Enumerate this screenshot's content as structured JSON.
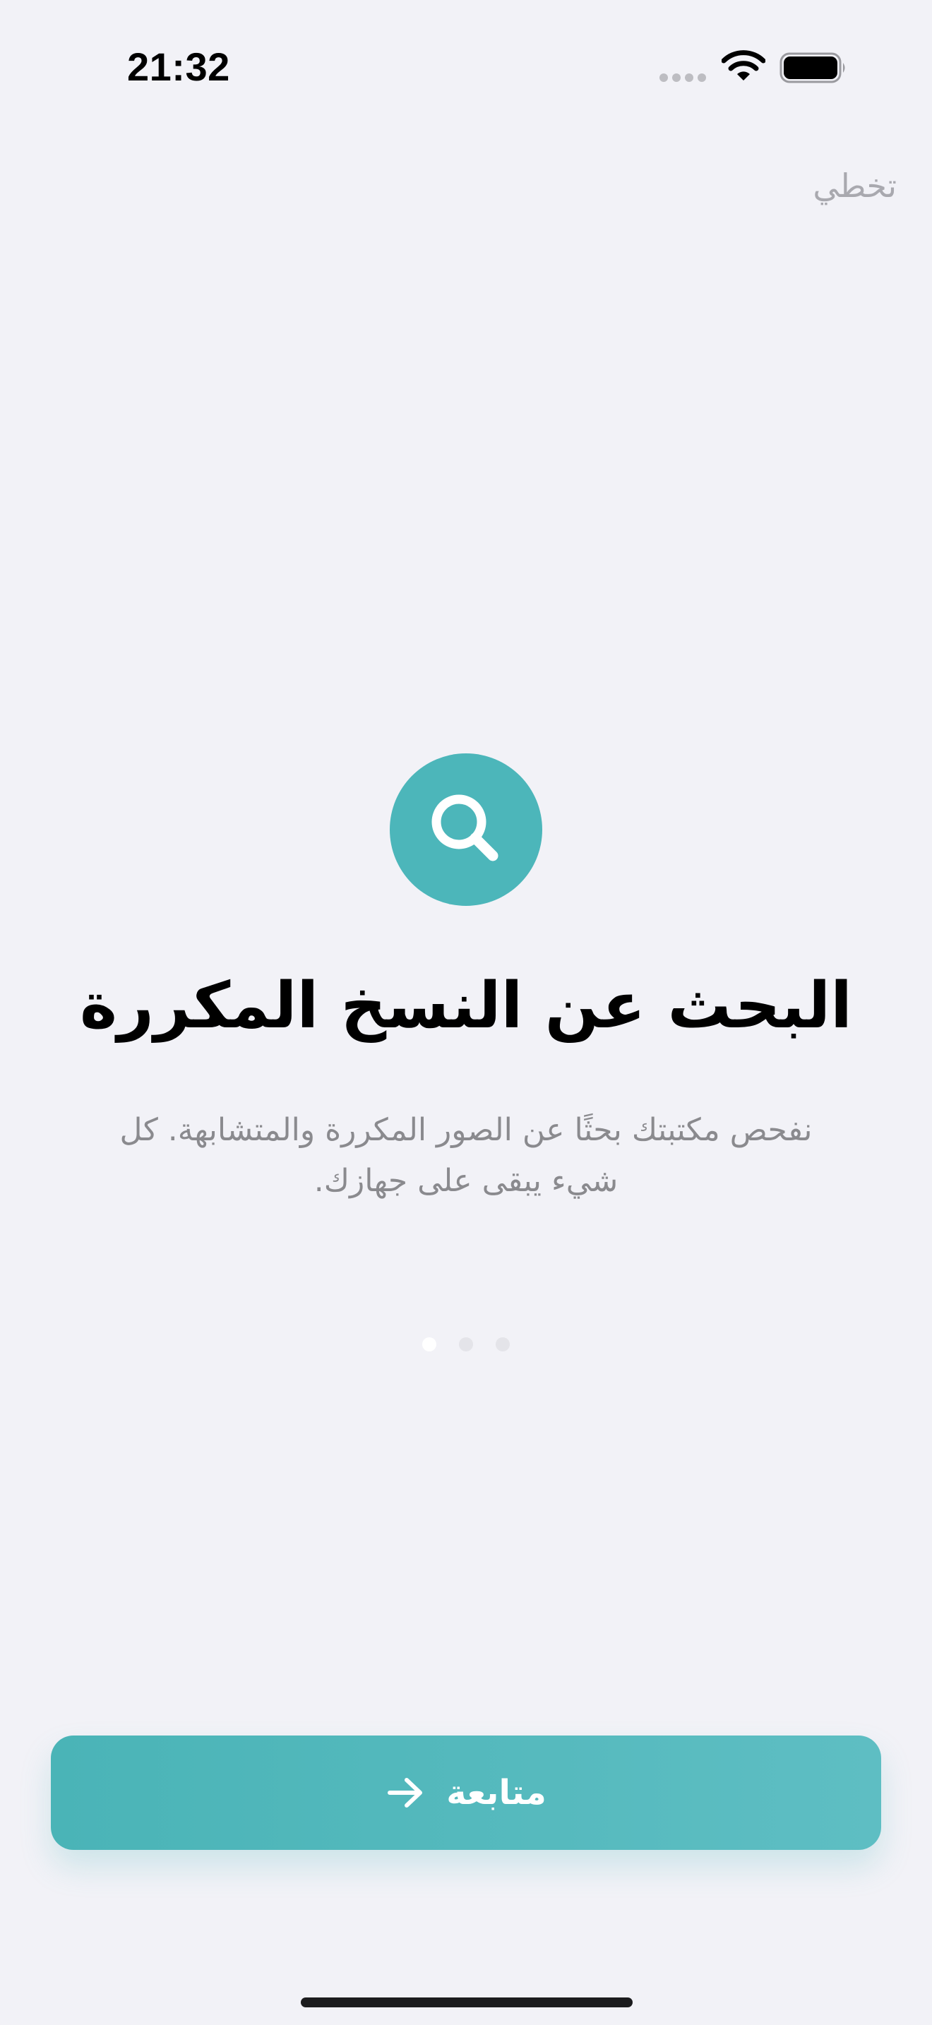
{
  "status_bar": {
    "time": "21:32",
    "icons": [
      "cellular-signal-icon",
      "wifi-icon",
      "battery-icon"
    ]
  },
  "header": {
    "skip_label": "تخطي"
  },
  "onboarding": {
    "icon": "magnifying-glass-icon",
    "title": "البحث عن النسخ المكررة",
    "description": "نفحص مكتبتك بحثًا عن الصور المكررة والمتشابهة. كل شيء يبقى على جهازك.",
    "page_count": 3,
    "current_page": 1
  },
  "footer": {
    "continue_label": "متابعة",
    "continue_icon": "arrow-right-icon"
  },
  "colors": {
    "background": "#F2F2F7",
    "accent": "#4CB6BA",
    "secondary_text": "#8A8A8E",
    "skip_text": "#A9A9AF"
  }
}
